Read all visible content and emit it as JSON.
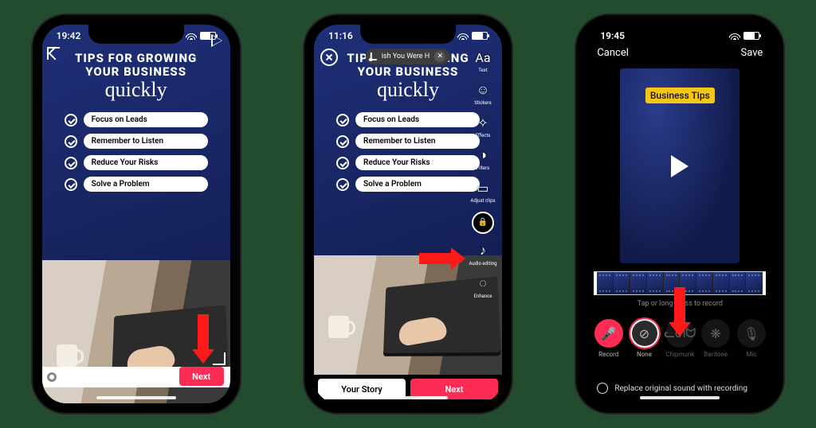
{
  "status": {
    "time1": "19:42",
    "time2": "11:16",
    "time3": "19:45"
  },
  "template": {
    "line1": "TIPS FOR GROWING",
    "line2": "YOUR BUSINESS",
    "script": "quickly",
    "tips": [
      "Focus on Leads",
      "Remember to Listen",
      "Reduce Your Risks",
      "Solve a Problem"
    ]
  },
  "phone1": {
    "next": "Next"
  },
  "phone2": {
    "music": "ish You Were H",
    "tools": [
      {
        "icon": "Aa",
        "label": "Text"
      },
      {
        "icon": "☺",
        "label": "Stickers"
      },
      {
        "icon": "✧",
        "label": "Effects"
      },
      {
        "icon": "◑",
        "label": "Filters"
      },
      {
        "icon": "▭",
        "label": "Adjust clips"
      },
      {
        "icon": "",
        "label": ""
      },
      {
        "icon": "♪",
        "label": "Audio editing"
      },
      {
        "icon": "◌",
        "label": "Enhance"
      }
    ],
    "privacy": "Privacy settings",
    "story": "Your Story",
    "next": "Next"
  },
  "phone3": {
    "cancel": "Cancel",
    "save": "Save",
    "tag": "Business Tips",
    "hint": "Tap or long press to record",
    "voices": [
      {
        "key": "record",
        "icon": "🎤",
        "label": "Record"
      },
      {
        "key": "none",
        "icon": "⊘",
        "label": "None"
      },
      {
        "key": "chipmunk",
        "icon": "ᓚᘏᗢ",
        "label": "Chipmunk"
      },
      {
        "key": "baritone",
        "icon": "❋",
        "label": "Baritone"
      },
      {
        "key": "mic",
        "icon": "🎙",
        "label": "Mic"
      }
    ],
    "replace": "Replace original sound with recording"
  }
}
